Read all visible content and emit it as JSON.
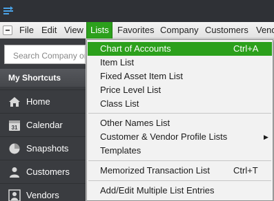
{
  "colors": {
    "accent": "#2ca01c",
    "sidebar": "#3a3c40",
    "titlebar": "#2f3136"
  },
  "menubar": {
    "items": [
      "File",
      "Edit",
      "View",
      "Lists",
      "Favorites",
      "Company",
      "Customers",
      "Vendo"
    ],
    "active": "Lists"
  },
  "sidebar": {
    "search_placeholder": "Search Company or H",
    "header": "My Shortcuts",
    "items": [
      {
        "label": "Home",
        "icon": "home-icon"
      },
      {
        "label": "Calendar",
        "icon": "calendar-icon",
        "icon_text": "31"
      },
      {
        "label": "Snapshots",
        "icon": "pie-chart-icon"
      },
      {
        "label": "Customers",
        "icon": "customer-icon"
      },
      {
        "label": "Vendors",
        "icon": "vendor-icon"
      }
    ]
  },
  "lists_menu": {
    "items": [
      {
        "label": "Chart of Accounts",
        "shortcut": "Ctrl+A",
        "highlighted": true
      },
      {
        "label": "Item List"
      },
      {
        "label": "Fixed Asset Item List"
      },
      {
        "label": "Price Level List"
      },
      {
        "label": "Class List"
      },
      {
        "label": "Other Names List"
      },
      {
        "label": "Customer & Vendor Profile Lists",
        "submenu": true
      },
      {
        "label": "Templates"
      },
      {
        "label": "Memorized Transaction List",
        "shortcut": "Ctrl+T"
      },
      {
        "label": "Add/Edit Multiple List Entries"
      }
    ],
    "submenu_arrow": "▶"
  }
}
